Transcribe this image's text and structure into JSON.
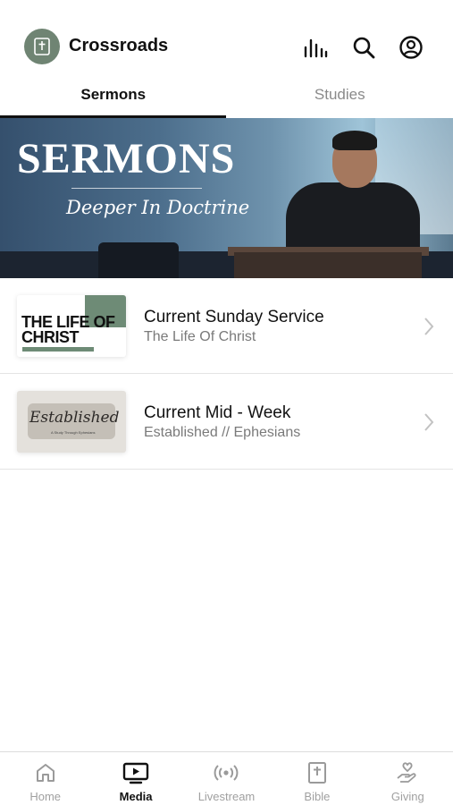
{
  "header": {
    "app_name": "Crossroads",
    "icons": [
      "bar-chart-icon",
      "search-icon",
      "account-icon"
    ]
  },
  "tabs": [
    {
      "label": "Sermons",
      "active": true
    },
    {
      "label": "Studies",
      "active": false
    }
  ],
  "banner": {
    "title": "SERMONS",
    "subtitle": "Deeper In Doctrine"
  },
  "list": [
    {
      "title": "Current Sunday Service",
      "subtitle": "The Life Of Christ",
      "thumb_text": "THE LIFE OF CHRIST"
    },
    {
      "title": "Current Mid - Week",
      "subtitle": "Established // Ephesians",
      "thumb_text": "Established",
      "thumb_small": "A Study Through Ephesians"
    }
  ],
  "tabbar": [
    {
      "label": "Home",
      "icon": "home-icon",
      "active": false
    },
    {
      "label": "Media",
      "icon": "media-icon",
      "active": true
    },
    {
      "label": "Livestream",
      "icon": "livestream-icon",
      "active": false
    },
    {
      "label": "Bible",
      "icon": "bible-icon",
      "active": false
    },
    {
      "label": "Giving",
      "icon": "giving-icon",
      "active": false
    }
  ],
  "colors": {
    "brand_green": "#6f8473",
    "text": "#111111",
    "muted": "#8a8a8a"
  }
}
